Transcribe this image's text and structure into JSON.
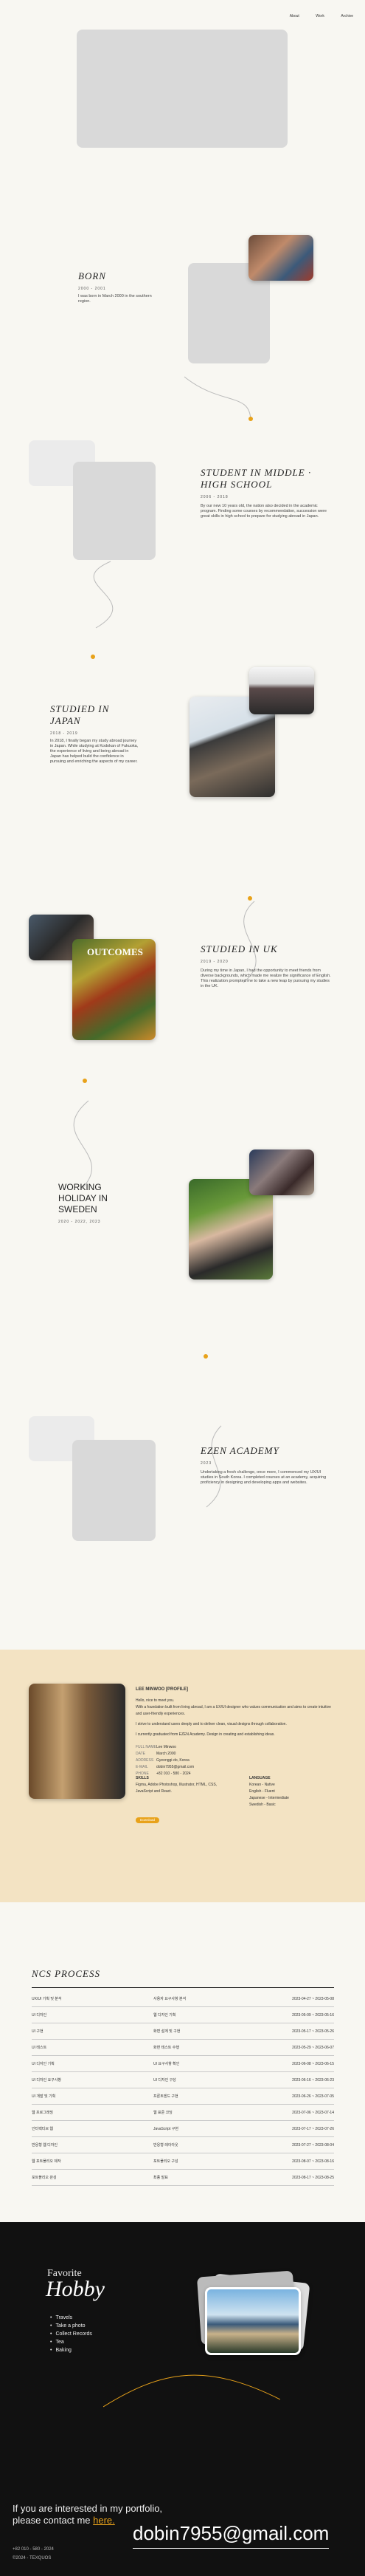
{
  "nav": {
    "items": [
      "About",
      "Work",
      "Archive"
    ]
  },
  "timeline": {
    "born": {
      "title": "BORN",
      "date": "2000 - 2001",
      "desc": "I was born in March 2000 in the southern region."
    },
    "school": {
      "title": "STUDENT IN MIDDLE · HIGH SCHOOL",
      "date": "2006 - 2018",
      "desc": "By our new 10 years old, the nation also decided in the academic program. Finding some courses by recommendation, succession were great skills in high school to prepare for studying abroad in Japan."
    },
    "japan": {
      "title": "STUDIED IN JAPAN",
      "date": "2018 - 2019",
      "desc": "In 2018, I finally began my study abroad journey in Japan. While studying at Kodokan of Fukuoka, the experience of living and being abroad in Japan has helped build the confidence in pursuing and enriching the aspects of my career."
    },
    "uk": {
      "title": "STUDIED IN UK",
      "date": "2019 - 2020",
      "desc": "During my time in Japan, I had the opportunity to meet friends from diverse backgrounds, which made me realize the significance of English. This realization prompted me to take a new leap by pursuing my studies in the UK."
    },
    "sweden": {
      "title": "WORKING HOLIDAY IN SWEDEN",
      "date": "2020 - 2022, 2023"
    },
    "ezen": {
      "title": "EZEN ACADEMY",
      "date": "2023",
      "desc": "Undertaking a fresh challenge, once more, I commenced my UX/UI studies in South Korea. I completed courses at an academy, acquiring proficiency in designing and developing apps and websites."
    },
    "uk_photo_caption": "OUTCOMES"
  },
  "profile": {
    "name": "LEE MINWOO [PROFILE]",
    "intro1": "Hello, nice to meet you.",
    "intro2": "With a foundation built from living abroad, I am a UX/UI designer who values communication and aims to create intuitive and user-friendly experiences.",
    "intro3": "I strive to understand users deeply and to deliver clean, visual designs through collaboration.",
    "intro4": "I currently graduated from EZEN Academy. Design in creating and establishing ideas.",
    "fields": [
      {
        "label": "FULL NAME",
        "value": "Lee Minwoo"
      },
      {
        "label": "DATE",
        "value": "March 2000"
      },
      {
        "label": "ADDRESS",
        "value": "Gyeonggi-do, Korea"
      },
      {
        "label": "E-MAIL",
        "value": "dobin7955@gmail.com"
      },
      {
        "label": "PHONE",
        "value": "+82 010 - 580 - 2024"
      }
    ],
    "skills_title": "SKILLS",
    "skills_desc": "Figma, Adobe Photoshop, Illustrator, HTML, CSS, JavaScript and React.",
    "language_title": "LANGUAGE",
    "languages": [
      "Korean - Native",
      "English - Fluent",
      "Japanese - Intermediate",
      "Swedish - Basic"
    ],
    "button": "Download"
  },
  "ncs": {
    "title": "NCS PROCESS",
    "rows": [
      {
        "name": "UX/UI 기획 및 분석",
        "detail": "사용자 요구사항 분석",
        "date": "2023-04-27 ~ 2023-05-08"
      },
      {
        "name": "UI 디자인",
        "detail": "웹 디자인 기획",
        "date": "2023-05-09 ~ 2023-05-16"
      },
      {
        "name": "UI 구현",
        "detail": "화면 설계 및 구현",
        "date": "2023-05-17 ~ 2023-05-26"
      },
      {
        "name": "UI 테스트",
        "detail": "화면 테스트 수행",
        "date": "2023-05-29 ~ 2023-06-07"
      },
      {
        "name": "UI 디자인 기획",
        "detail": "UI 요구사항 확인",
        "date": "2023-06-08 ~ 2023-06-15"
      },
      {
        "name": "UI 디자인 요구사항",
        "detail": "UI 디자인 구성",
        "date": "2023-06-16 ~ 2023-06-23"
      },
      {
        "name": "UI 개발 및 기획",
        "detail": "프론트엔드 구현",
        "date": "2023-06-26 ~ 2023-07-05"
      },
      {
        "name": "웹 프로그래밍",
        "detail": "웹 표준 코딩",
        "date": "2023-07-06 ~ 2023-07-14"
      },
      {
        "name": "인터랙티브 웹",
        "detail": "JavaScript 구현",
        "date": "2023-07-17 ~ 2023-07-26"
      },
      {
        "name": "반응형 웹 디자인",
        "detail": "반응형 레이아웃",
        "date": "2023-07-27 ~ 2023-08-04"
      },
      {
        "name": "웹 포트폴리오 제작",
        "detail": "포트폴리오 구성",
        "date": "2023-08-07 ~ 2023-08-16"
      },
      {
        "name": "포트폴리오 완성",
        "detail": "최종 발표",
        "date": "2023-08-17 ~ 2023-08-25"
      }
    ]
  },
  "hobby": {
    "small": "Favorite",
    "big": "Hobby",
    "items": [
      "Travels",
      "Take a photo",
      "Collect Records",
      "Tea",
      "Baking"
    ]
  },
  "contact": {
    "line1": "If you are interested in my portfolio,",
    "line2": "please contact me",
    "here": "here.",
    "email": "dobin7955@gmail.com",
    "phone": "+82 010 - 580 - 2024",
    "copyright": "©2024 - TEXQUOS"
  },
  "colors": {
    "accent": "#e8a21a",
    "profile_bg": "#f3e3c3",
    "dark": "#111111"
  }
}
